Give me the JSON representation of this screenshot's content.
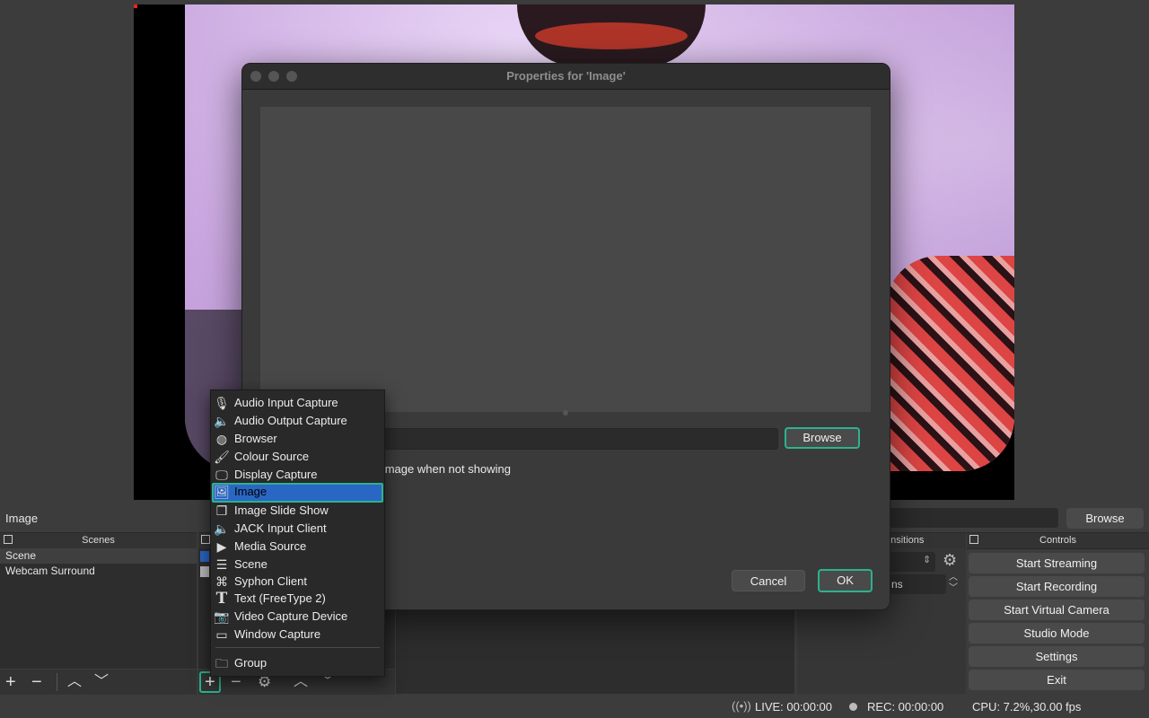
{
  "dialog": {
    "title": "Properties for 'Image'",
    "browse_label": "Browse",
    "unload_checkbox_label": "d image when not showing",
    "cancel_label": "Cancel",
    "ok_label": "OK"
  },
  "source_bar": {
    "name": "Image",
    "browse_label": "Browse"
  },
  "scenes": {
    "title": "Scenes",
    "items": [
      "Scene",
      "Webcam Surround"
    ]
  },
  "transitions": {
    "title_fragment": "ansitions",
    "duration_fragment": "ns"
  },
  "controls": {
    "title": "Controls",
    "buttons": [
      "Start Streaming",
      "Start Recording",
      "Start Virtual Camera",
      "Studio Mode",
      "Settings",
      "Exit"
    ]
  },
  "status": {
    "live": "LIVE: 00:00:00",
    "rec": "REC: 00:00:00",
    "cpu": "CPU: 7.2%,30.00 fps"
  },
  "add_source_menu": {
    "items": [
      {
        "label": "Audio Input Capture",
        "icon": "microphone-icon"
      },
      {
        "label": "Audio Output Capture",
        "icon": "speaker-icon"
      },
      {
        "label": "Browser",
        "icon": "globe-icon"
      },
      {
        "label": "Colour Source",
        "icon": "paintbrush-icon"
      },
      {
        "label": "Display Capture",
        "icon": "monitor-icon"
      },
      {
        "label": "Image",
        "icon": "image-icon",
        "selected": true
      },
      {
        "label": "Image Slide Show",
        "icon": "slideshow-icon"
      },
      {
        "label": "JACK Input Client",
        "icon": "speaker-icon"
      },
      {
        "label": "Media Source",
        "icon": "play-icon"
      },
      {
        "label": "Scene",
        "icon": "list-icon"
      },
      {
        "label": "Syphon Client",
        "icon": "gamepad-icon"
      },
      {
        "label": "Text (FreeType 2)",
        "icon": "text-icon"
      },
      {
        "label": "Video Capture Device",
        "icon": "camera-icon"
      },
      {
        "label": "Window Capture",
        "icon": "window-icon"
      }
    ],
    "group_label": "Group",
    "group_icon": "folder-icon"
  },
  "colors": {
    "accent_focus": "#2bb38e",
    "selection": "#2a67c4"
  }
}
